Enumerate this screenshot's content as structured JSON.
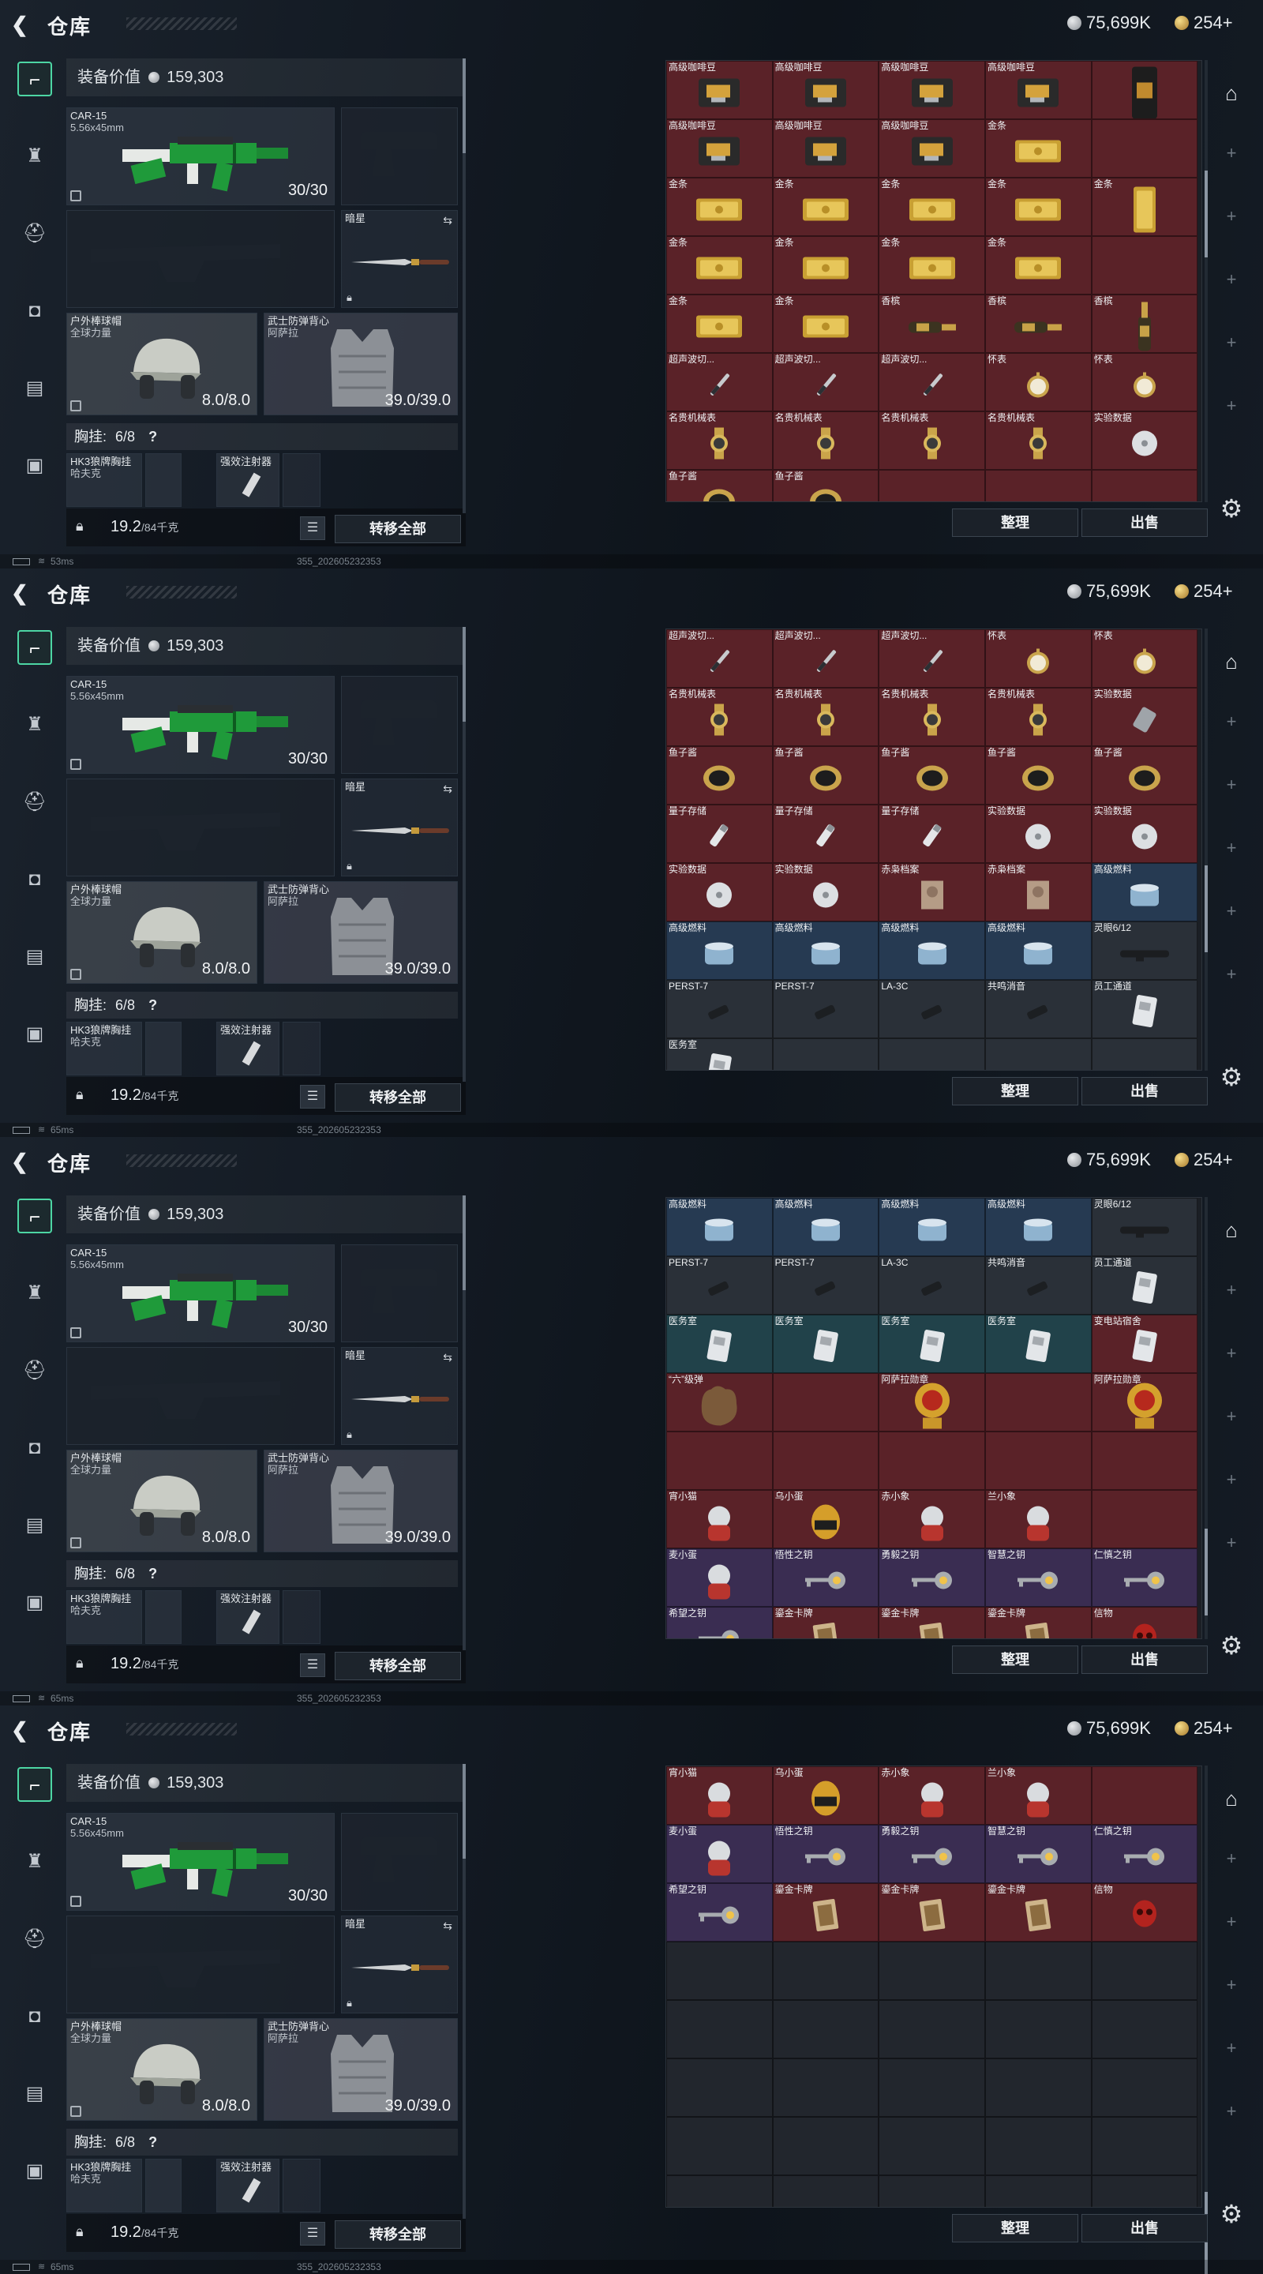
{
  "header": {
    "back_icon": "chevron-left-icon",
    "title": "仓库",
    "silver_amount": "75,699K",
    "gold_amount": "254+"
  },
  "loadout": {
    "value_label": "装备价值",
    "value_amount": "159,303",
    "primary_weapon_name": "CAR-15",
    "primary_weapon_caliber": "5.56x45mm",
    "primary_weapon_durability": "30/30",
    "melee_name": "暗星",
    "helmet_name": "户外棒球帽",
    "helmet_sub": "全球力量",
    "helmet_durability": "8.0/8.0",
    "armor_name": "武士防弹背心",
    "armor_sub": "阿萨拉",
    "armor_durability": "39.0/39.0",
    "chest_label": "胸挂:",
    "chest_count": "6/8",
    "chest_help": "?",
    "chest_item1": "HK3狼牌胸挂",
    "chest_item1_sub": "哈夫克",
    "chest_item2": "强效注射器",
    "weight_value": "19.2",
    "weight_unit": "/84千克",
    "transfer_all": "转移全部"
  },
  "grid_buttons": {
    "sort": "整理",
    "sell": "出售"
  },
  "status": {
    "ping_1": "53ms",
    "ping_2": "65ms",
    "ping_3": "65ms",
    "ping_4": "65ms",
    "build": "355_202605232353"
  },
  "icons": {
    "sidebar": [
      "pistol-icon",
      "vest-icon",
      "helmet-icon",
      "backpack-icon",
      "pouch-icon",
      "case-icon"
    ],
    "rail": [
      "stash-icon",
      "settings-gear-icon"
    ]
  },
  "grids": [
    [
      {
        "l": "高级咖啡豆",
        "c": "red",
        "a": "coffee"
      },
      {
        "l": "高级咖啡豆",
        "c": "red",
        "a": "coffee"
      },
      {
        "l": "高级咖啡豆",
        "c": "red",
        "a": "coffee"
      },
      {
        "l": "高级咖啡豆",
        "c": "red",
        "a": "coffee"
      },
      {
        "l": "",
        "c": "red",
        "a": "bag"
      },
      {
        "l": "高级咖啡豆",
        "c": "red",
        "a": "coffee"
      },
      {
        "l": "高级咖啡豆",
        "c": "red",
        "a": "coffee"
      },
      {
        "l": "高级咖啡豆",
        "c": "red",
        "a": "coffee"
      },
      {
        "l": "金条",
        "c": "red",
        "a": "gold"
      },
      {
        "l": "",
        "c": "red",
        "a": "none"
      },
      {
        "l": "金条",
        "c": "red",
        "a": "gold"
      },
      {
        "l": "金条",
        "c": "red",
        "a": "gold"
      },
      {
        "l": "金条",
        "c": "red",
        "a": "gold"
      },
      {
        "l": "金条",
        "c": "red",
        "a": "gold"
      },
      {
        "l": "金条",
        "c": "red",
        "a": "goldv"
      },
      {
        "l": "金条",
        "c": "red",
        "a": "gold"
      },
      {
        "l": "金条",
        "c": "red",
        "a": "gold"
      },
      {
        "l": "金条",
        "c": "red",
        "a": "gold"
      },
      {
        "l": "金条",
        "c": "red",
        "a": "gold"
      },
      {
        "l": "",
        "c": "red",
        "a": "none"
      },
      {
        "l": "金条",
        "c": "red",
        "a": "gold"
      },
      {
        "l": "金条",
        "c": "red",
        "a": "gold"
      },
      {
        "l": "香槟",
        "c": "red",
        "a": "bottle"
      },
      {
        "l": "香槟",
        "c": "red",
        "a": "bottle"
      },
      {
        "l": "香槟",
        "c": "red",
        "a": "bottlev"
      },
      {
        "l": "超声波切...",
        "c": "red",
        "a": "knife"
      },
      {
        "l": "超声波切...",
        "c": "red",
        "a": "knife"
      },
      {
        "l": "超声波切...",
        "c": "red",
        "a": "knife"
      },
      {
        "l": "怀表",
        "c": "red",
        "a": "watch"
      },
      {
        "l": "怀表",
        "c": "red",
        "a": "watch"
      },
      {
        "l": "名贵机械表",
        "c": "red",
        "a": "wrist"
      },
      {
        "l": "名贵机械表",
        "c": "red",
        "a": "wrist"
      },
      {
        "l": "名贵机械表",
        "c": "red",
        "a": "wrist"
      },
      {
        "l": "名贵机械表",
        "c": "red",
        "a": "wrist"
      },
      {
        "l": "实验数据",
        "c": "red",
        "a": "disc"
      },
      {
        "l": "鱼子酱",
        "c": "red",
        "a": "tin"
      },
      {
        "l": "鱼子酱",
        "c": "red",
        "a": "tin"
      },
      {
        "l": "",
        "c": "red",
        "a": "none"
      },
      {
        "l": "",
        "c": "red",
        "a": "none"
      },
      {
        "l": "",
        "c": "red",
        "a": "none"
      }
    ],
    [
      {
        "l": "超声波切...",
        "c": "red",
        "a": "knife"
      },
      {
        "l": "超声波切...",
        "c": "red",
        "a": "knife"
      },
      {
        "l": "超声波切...",
        "c": "red",
        "a": "knife"
      },
      {
        "l": "怀表",
        "c": "red",
        "a": "watch"
      },
      {
        "l": "怀表",
        "c": "red",
        "a": "watch"
      },
      {
        "l": "名贵机械表",
        "c": "red",
        "a": "wrist"
      },
      {
        "l": "名贵机械表",
        "c": "red",
        "a": "wrist"
      },
      {
        "l": "名贵机械表",
        "c": "red",
        "a": "wrist"
      },
      {
        "l": "名贵机械表",
        "c": "red",
        "a": "wrist"
      },
      {
        "l": "实验数据",
        "c": "red",
        "a": "drive"
      },
      {
        "l": "鱼子酱",
        "c": "red",
        "a": "tin"
      },
      {
        "l": "鱼子酱",
        "c": "red",
        "a": "tin"
      },
      {
        "l": "鱼子酱",
        "c": "red",
        "a": "tin"
      },
      {
        "l": "鱼子酱",
        "c": "red",
        "a": "tin"
      },
      {
        "l": "鱼子酱",
        "c": "red",
        "a": "tin"
      },
      {
        "l": "量子存储",
        "c": "red",
        "a": "usb"
      },
      {
        "l": "量子存储",
        "c": "red",
        "a": "usb"
      },
      {
        "l": "量子存储",
        "c": "red",
        "a": "usb"
      },
      {
        "l": "实验数据",
        "c": "red",
        "a": "disc"
      },
      {
        "l": "实验数据",
        "c": "red",
        "a": "disc"
      },
      {
        "l": "实验数据",
        "c": "red",
        "a": "disc"
      },
      {
        "l": "实验数据",
        "c": "red",
        "a": "disc"
      },
      {
        "l": "赤枭档案",
        "c": "red",
        "a": "doc"
      },
      {
        "l": "赤枭档案",
        "c": "red",
        "a": "doc"
      },
      {
        "l": "高级燃料",
        "c": "blue",
        "a": "fuel"
      },
      {
        "l": "高级燃料",
        "c": "blue",
        "a": "fuel"
      },
      {
        "l": "高级燃料",
        "c": "blue",
        "a": "fuel"
      },
      {
        "l": "高级燃料",
        "c": "blue",
        "a": "fuel"
      },
      {
        "l": "高级燃料",
        "c": "blue",
        "a": "fuel"
      },
      {
        "l": "灵眼6/12",
        "c": "gray",
        "a": "scope"
      },
      {
        "l": "PERST-7",
        "c": "gray",
        "a": "mod"
      },
      {
        "l": "PERST-7",
        "c": "gray",
        "a": "mod"
      },
      {
        "l": "LA-3C",
        "c": "gray",
        "a": "mod"
      },
      {
        "l": "共鸣消音",
        "c": "gray",
        "a": "mod"
      },
      {
        "l": "员工通道",
        "c": "gray",
        "a": "card"
      },
      {
        "l": "医务室",
        "c": "gray",
        "a": "card"
      },
      {
        "l": "",
        "c": "gray",
        "a": "none"
      },
      {
        "l": "",
        "c": "gray",
        "a": "none"
      },
      {
        "l": "",
        "c": "gray",
        "a": "none"
      },
      {
        "l": "",
        "c": "gray",
        "a": "none"
      }
    ],
    [
      {
        "l": "高级燃料",
        "c": "blue",
        "a": "fuel"
      },
      {
        "l": "高级燃料",
        "c": "blue",
        "a": "fuel"
      },
      {
        "l": "高级燃料",
        "c": "blue",
        "a": "fuel"
      },
      {
        "l": "高级燃料",
        "c": "blue",
        "a": "fuel"
      },
      {
        "l": "灵眼6/12",
        "c": "gray",
        "a": "scope"
      },
      {
        "l": "PERST-7",
        "c": "gray",
        "a": "mod"
      },
      {
        "l": "PERST-7",
        "c": "gray",
        "a": "mod"
      },
      {
        "l": "LA-3C",
        "c": "gray",
        "a": "mod"
      },
      {
        "l": "共鸣消音",
        "c": "gray",
        "a": "mod"
      },
      {
        "l": "员工通道",
        "c": "gray",
        "a": "card"
      },
      {
        "l": "医务室",
        "c": "teal",
        "a": "card"
      },
      {
        "l": "医务室",
        "c": "teal",
        "a": "card"
      },
      {
        "l": "医务室",
        "c": "teal",
        "a": "card"
      },
      {
        "l": "医务室",
        "c": "teal",
        "a": "card"
      },
      {
        "l": "变电站宿舍",
        "c": "red",
        "a": "card"
      },
      {
        "l": "“六”级弹",
        "c": "red",
        "a": "hand"
      },
      {
        "l": "",
        "c": "red",
        "a": "none"
      },
      {
        "l": "阿萨拉勋章",
        "c": "red",
        "a": "medal"
      },
      {
        "l": "",
        "c": "red",
        "a": "none"
      },
      {
        "l": "阿萨拉勋章",
        "c": "red",
        "a": "medal"
      },
      {
        "l": "",
        "c": "red",
        "a": "none"
      },
      {
        "l": "",
        "c": "red",
        "a": "none"
      },
      {
        "l": "",
        "c": "red",
        "a": "none"
      },
      {
        "l": "",
        "c": "red",
        "a": "none"
      },
      {
        "l": "",
        "c": "red",
        "a": "none"
      },
      {
        "l": "宵小猫",
        "c": "red",
        "a": "toy"
      },
      {
        "l": "乌小蛋",
        "c": "red",
        "a": "egg"
      },
      {
        "l": "赤小象",
        "c": "red",
        "a": "toy"
      },
      {
        "l": "兰小象",
        "c": "red",
        "a": "toy"
      },
      {
        "l": "",
        "c": "red",
        "a": "none"
      },
      {
        "l": "麦小蛋",
        "c": "purple",
        "a": "toy"
      },
      {
        "l": "悟性之钥",
        "c": "purple",
        "a": "key"
      },
      {
        "l": "勇毅之钥",
        "c": "purple",
        "a": "key"
      },
      {
        "l": "智慧之钥",
        "c": "purple",
        "a": "key"
      },
      {
        "l": "仁慎之钥",
        "c": "purple",
        "a": "key"
      },
      {
        "l": "希望之钥",
        "c": "purple",
        "a": "key"
      },
      {
        "l": "鎏金卡牌",
        "c": "red",
        "a": "tarot"
      },
      {
        "l": "鎏金卡牌",
        "c": "red",
        "a": "tarot"
      },
      {
        "l": "鎏金卡牌",
        "c": "red",
        "a": "tarot"
      },
      {
        "l": "信物",
        "c": "red",
        "a": "skull"
      }
    ],
    [
      {
        "l": "宵小猫",
        "c": "red",
        "a": "toy"
      },
      {
        "l": "乌小蛋",
        "c": "red",
        "a": "egg"
      },
      {
        "l": "赤小象",
        "c": "red",
        "a": "toy"
      },
      {
        "l": "兰小象",
        "c": "red",
        "a": "toy"
      },
      {
        "l": "",
        "c": "red",
        "a": "none"
      },
      {
        "l": "麦小蛋",
        "c": "purple",
        "a": "toy"
      },
      {
        "l": "悟性之钥",
        "c": "purple",
        "a": "key"
      },
      {
        "l": "勇毅之钥",
        "c": "purple",
        "a": "key"
      },
      {
        "l": "智慧之钥",
        "c": "purple",
        "a": "key"
      },
      {
        "l": "仁慎之钥",
        "c": "purple",
        "a": "key"
      },
      {
        "l": "希望之钥",
        "c": "purple",
        "a": "key"
      },
      {
        "l": "鎏金卡牌",
        "c": "red",
        "a": "tarot"
      },
      {
        "l": "鎏金卡牌",
        "c": "red",
        "a": "tarot"
      },
      {
        "l": "鎏金卡牌",
        "c": "red",
        "a": "tarot"
      },
      {
        "l": "信物",
        "c": "red",
        "a": "skull"
      },
      {
        "l": "",
        "c": "empty",
        "a": "none"
      },
      {
        "l": "",
        "c": "empty",
        "a": "none"
      },
      {
        "l": "",
        "c": "empty",
        "a": "none"
      },
      {
        "l": "",
        "c": "empty",
        "a": "none"
      },
      {
        "l": "",
        "c": "empty",
        "a": "none"
      },
      {
        "l": "",
        "c": "empty",
        "a": "none"
      },
      {
        "l": "",
        "c": "empty",
        "a": "none"
      },
      {
        "l": "",
        "c": "empty",
        "a": "none"
      },
      {
        "l": "",
        "c": "empty",
        "a": "none"
      },
      {
        "l": "",
        "c": "empty",
        "a": "none"
      },
      {
        "l": "",
        "c": "empty",
        "a": "none"
      },
      {
        "l": "",
        "c": "empty",
        "a": "none"
      },
      {
        "l": "",
        "c": "empty",
        "a": "none"
      },
      {
        "l": "",
        "c": "empty",
        "a": "none"
      },
      {
        "l": "",
        "c": "empty",
        "a": "none"
      },
      {
        "l": "",
        "c": "empty",
        "a": "none"
      },
      {
        "l": "",
        "c": "empty",
        "a": "none"
      },
      {
        "l": "",
        "c": "empty",
        "a": "none"
      },
      {
        "l": "",
        "c": "empty",
        "a": "none"
      },
      {
        "l": "",
        "c": "empty",
        "a": "none"
      },
      {
        "l": "",
        "c": "empty",
        "a": "none"
      },
      {
        "l": "",
        "c": "empty",
        "a": "none"
      },
      {
        "l": "",
        "c": "empty",
        "a": "none"
      },
      {
        "l": "",
        "c": "empty",
        "a": "none"
      },
      {
        "l": "",
        "c": "empty",
        "a": "none"
      }
    ]
  ]
}
